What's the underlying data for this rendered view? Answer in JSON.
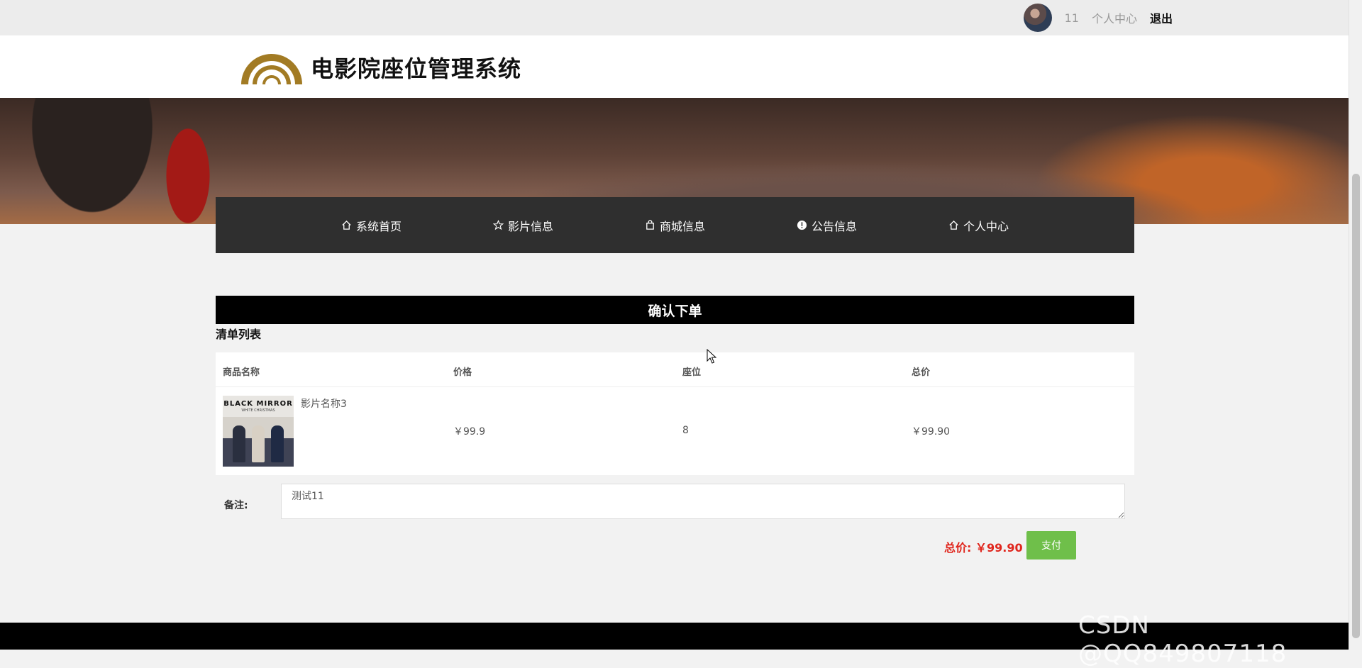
{
  "topbar": {
    "username": "11",
    "user_center": "个人中心",
    "logout": "退出"
  },
  "header": {
    "title": "电影院座位管理系统"
  },
  "nav": [
    {
      "label": "系统首页",
      "icon": "home-icon"
    },
    {
      "label": "影片信息",
      "icon": "star-icon"
    },
    {
      "label": "商城信息",
      "icon": "shopping-bag-icon"
    },
    {
      "label": "公告信息",
      "icon": "alert-circle-icon"
    },
    {
      "label": "个人中心",
      "icon": "home-icon"
    }
  ],
  "order": {
    "heading": "确认下单",
    "list_title": "清单列表",
    "columns": [
      "商品名称",
      "价格",
      "座位",
      "总价"
    ],
    "rows": [
      {
        "name": "影片名称3",
        "price": "￥99.9",
        "seat": "8",
        "total": "￥99.90",
        "poster_title": "BLACK MIRROR",
        "poster_subtitle": "WHITE CHRISTMAS"
      }
    ],
    "remark_label": "备注:",
    "remark_value": "测试11",
    "total_label": "总价: ￥99.90",
    "pay_label": "支付"
  },
  "colors": {
    "nav_bg": "#2f2f2f",
    "pay": "#6fbf4a",
    "total": "#e0251c"
  },
  "watermark": "CSDN @QQ849807118"
}
